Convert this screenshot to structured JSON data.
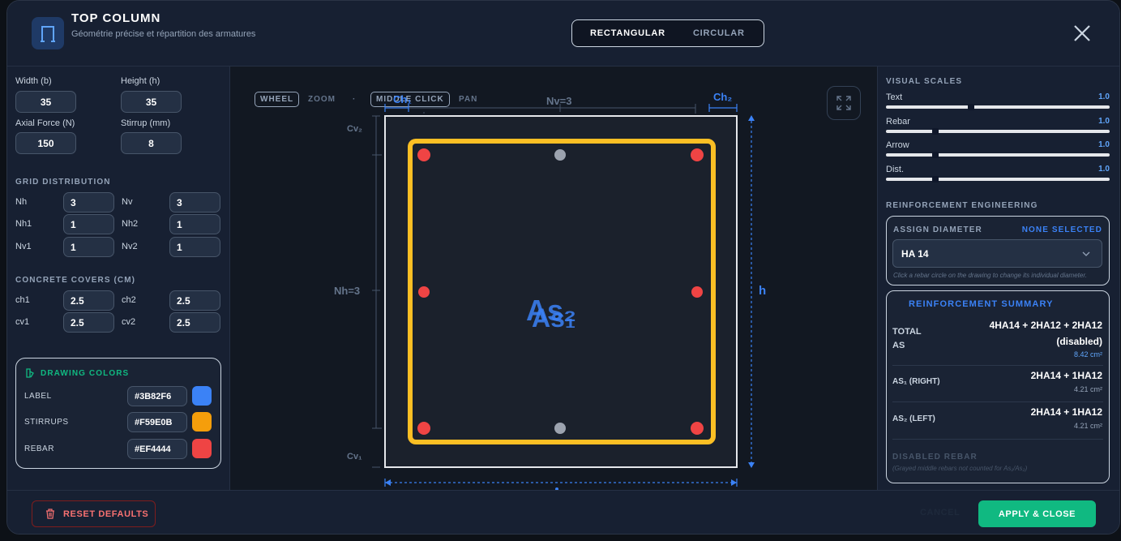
{
  "header": {
    "title": "TOP COLUMN",
    "subtitle": "Géométrie précise et répartition des armatures",
    "shape_tabs": [
      "RECTANGULAR",
      "CIRCULAR"
    ],
    "active_shape": "RECTANGULAR"
  },
  "inputs": {
    "width_label": "Width (b)",
    "width_value": "35",
    "height_label": "Height (h)",
    "height_value": "35",
    "axial_label": "Axial Force (N)",
    "axial_value": "150",
    "stirrup_label": "Stirrup (mm)",
    "stirrup_value": "8"
  },
  "grid": {
    "title": "GRID DISTRIBUTION",
    "nh_label": "Nh",
    "nh": "3",
    "nv_label": "Nv",
    "nv": "3",
    "nh1_label": "Nh1",
    "nh1": "1",
    "nh2_label": "Nh2",
    "nh2": "1",
    "nv1_label": "Nv1",
    "nv1": "1",
    "nv2_label": "Nv2",
    "nv2": "1"
  },
  "covers": {
    "title": "CONCRETE COVERS (CM)",
    "ch1_label": "ch1",
    "ch1": "2.5",
    "ch2_label": "ch2",
    "ch2": "2.5",
    "cv1_label": "cv1",
    "cv1": "2.5",
    "cv2_label": "cv2",
    "cv2": "2.5"
  },
  "colors": {
    "title": "DRAWING COLORS",
    "label_name": "LABEL",
    "label_hex": "#3B82F6",
    "stirrups_name": "STIRRUPS",
    "stirrups_hex": "#F59E0B",
    "rebar_name": "REBAR",
    "rebar_hex": "#EF4444"
  },
  "canvas": {
    "hint_wheel": "WHEEL",
    "hint_zoom": "ZOOM",
    "hint_dot": "·",
    "hint_middle": "MIDDLE CLICK",
    "hint_pan": "PAN",
    "label_ch1": "Ch₁",
    "label_ch2": "Ch₂",
    "label_nv": "Nv=3",
    "label_cv2": "Cv₂",
    "label_cv1": "Cv₁",
    "label_nh": "Nh=3",
    "label_h": "h",
    "label_as1": "As₁",
    "label_as2": "As₂",
    "label_a": "A"
  },
  "scales": {
    "title": "VISUAL SCALES",
    "items": [
      {
        "label": "Text",
        "value": "1.0",
        "level": 0.38
      },
      {
        "label": "Rebar",
        "value": "1.0",
        "level": 0.22
      },
      {
        "label": "Arrow",
        "value": "1.0",
        "level": 0.22
      },
      {
        "label": "Dist.",
        "value": "1.0",
        "level": 0.22
      }
    ]
  },
  "engineering": {
    "title": "REINFORCEMENT ENGINEERING",
    "assign_label": "ASSIGN DIAMETER",
    "selection_status": "NONE SELECTED",
    "diameter_value": "HA 14",
    "assign_hint": "Click a rebar circle on the drawing to change its individual diameter."
  },
  "summary": {
    "title": "REINFORCEMENT SUMMARY",
    "total_label": "TOTAL AS",
    "total_formula": "4HA14 + 2HA12 + 2HA12 (disabled)",
    "total_area": "8.42 cm²",
    "as1_label": "AS₁ (RIGHT)",
    "as1_formula": "2HA14 + 1HA12",
    "as1_area": "4.21 cm²",
    "as2_label": "AS₂ (LEFT)",
    "as2_formula": "2HA14 + 1HA12",
    "as2_area": "4.21 cm²",
    "disabled_label": "DISABLED REBAR",
    "disabled_note": "(Grayed middle rebars not counted for As₁/As₂)"
  },
  "footer": {
    "reset_label": "RESET DEFAULTS",
    "cancel_label": "CANCEL",
    "apply_label": "APPLY & CLOSE"
  },
  "theme": {
    "accent": "#3B82F6",
    "stirrup": "#F59E0B",
    "rebar": "#EF4444",
    "disabled": "#9CA3AF",
    "apply": "#10B981"
  }
}
